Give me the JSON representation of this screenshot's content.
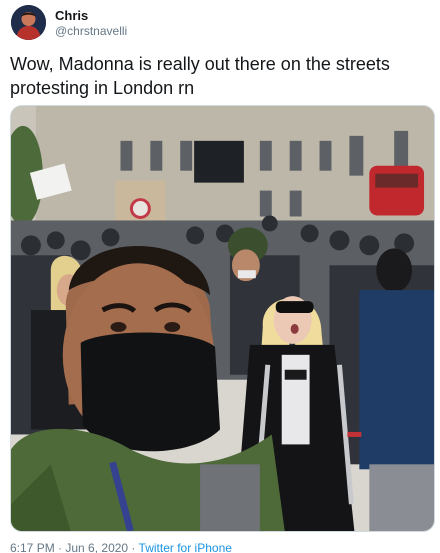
{
  "user": {
    "display_name": "Chris",
    "handle": "@chrstnavelli"
  },
  "tweet": {
    "text": "Wow, Madonna is really out there on the streets protesting in London rn"
  },
  "meta": {
    "time": "6:17 PM",
    "separator": " · ",
    "date": "Jun 6, 2020",
    "source": "Twitter for iPhone"
  },
  "colors": {
    "text": "#14171a",
    "secondary": "#657786",
    "link": "#1b95e0"
  }
}
